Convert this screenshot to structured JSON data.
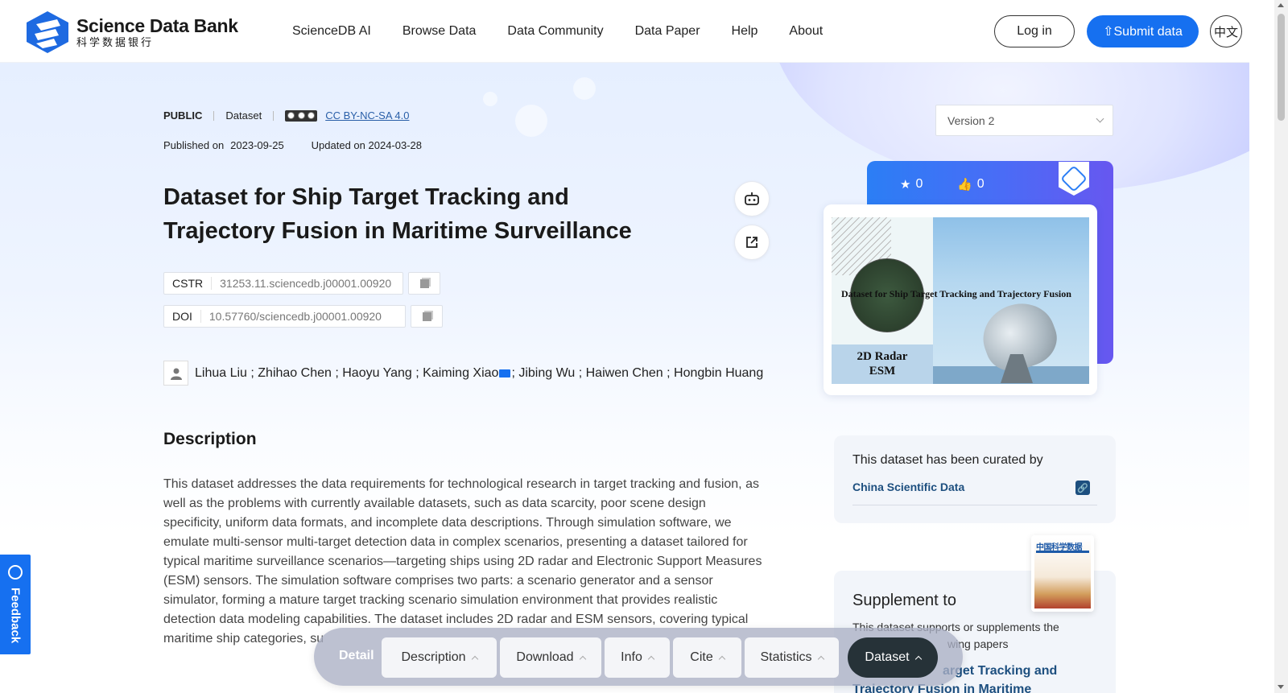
{
  "header": {
    "logo_en": "Science Data Bank",
    "logo_cn": "科学数据银行",
    "nav": [
      "ScienceDB AI",
      "Browse Data",
      "Data Community",
      "Data Paper",
      "Help",
      "About"
    ],
    "login": "Log in",
    "submit": "Submit data",
    "lang": "中文"
  },
  "meta": {
    "visibility": "PUBLIC",
    "type": "Dataset",
    "license": "CC BY-NC-SA 4.0",
    "published_label": "Published on",
    "published_date": "2023-09-25",
    "updated": "Updated on 2024-03-28"
  },
  "title": "Dataset for Ship Target Tracking and Trajectory Fusion in Maritime Surveillance",
  "identifiers": {
    "cstr_label": "CSTR",
    "cstr_value": "31253.11.sciencedb.j00001.00920",
    "doi_label": "DOI",
    "doi_value": "10.57760/sciencedb.j00001.00920"
  },
  "authors": {
    "before": "Lihua Liu ; Zhihao Chen ; Haoyu Yang ; Kaiming Xiao",
    "after": "; Jibing Wu ; Haiwen Chen ; Hongbin Huang"
  },
  "description": {
    "heading": "Description",
    "text": "This dataset addresses the data requirements for technological research in target tracking and fusion, as well as the problems with currently available datasets, such as data scarcity, poor scene design specificity, uniform data formats, and incomplete data descriptions. Through simulation software, we emulate multi-sensor multi-target detection data in complex scenarios, presenting a dataset tailored for typical maritime surveillance scenarios—targeting ships using 2D radar and Electronic Support Measures (ESM) sensors. The simulation software comprises two parts: a scenario generator and a sensor simulator, forming a mature target tracking scenario simulation environment that provides realistic detection data modeling capabilities. The dataset includes 2D radar and ESM sensors, covering typical maritime ship categories, su"
  },
  "version": "Version 2",
  "stats": {
    "stars": "0",
    "likes": "0"
  },
  "cover": {
    "title": "Dataset for Ship Target Tracking and Trajectory Fusion",
    "label_line1": "2D Radar",
    "label_line2": "ESM"
  },
  "curated": {
    "text": "This dataset has been curated by",
    "org": "China Scientific Data"
  },
  "supplement": {
    "heading": "Supplement to",
    "desc": "This dataset supports or supplements the",
    "desc2": "wing papers",
    "paper_line1": "arget Tracking and",
    "paper_line2": "Trajectory Fusion in Maritime"
  },
  "journal": {
    "masthead": "中国科学数据"
  },
  "feedback": "Feedback",
  "tabbar": {
    "detail": "Detail",
    "tabs": [
      "Description",
      "Download",
      "Info",
      "Cite",
      "Statistics",
      "Dataset"
    ]
  }
}
